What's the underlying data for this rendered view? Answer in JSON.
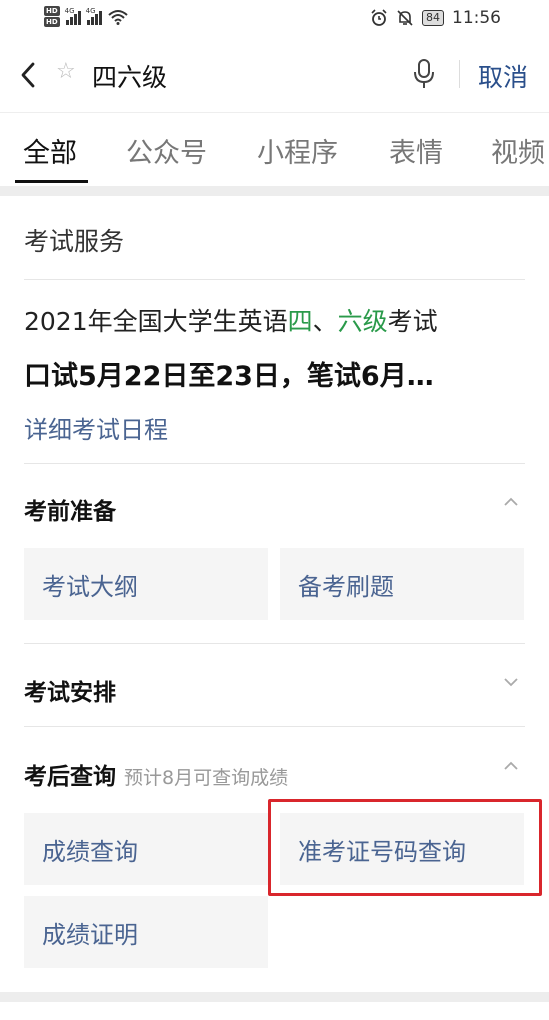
{
  "status_bar": {
    "hd_badges": [
      "HD",
      "HD"
    ],
    "sim1_network": "4G",
    "sim2_network": "4G",
    "battery": "84",
    "time": "11:56",
    "icons": [
      "signal-icon",
      "wifi-icon",
      "alarm-icon",
      "mute-icon",
      "battery-icon"
    ]
  },
  "header": {
    "query": "四六级",
    "cancel_label": "取消",
    "icons": [
      "back-icon",
      "star-icon",
      "mic-icon"
    ]
  },
  "tabs": [
    {
      "label": "全部",
      "active": true
    },
    {
      "label": "公众号",
      "active": false
    },
    {
      "label": "小程序",
      "active": false
    },
    {
      "label": "表情",
      "active": false
    },
    {
      "label": "视频",
      "active": false
    }
  ],
  "card": {
    "title": "考试服务",
    "exam": {
      "line1_prefix": "2021年全国大学生英语",
      "line1_hl1": "四",
      "line1_sep": "、",
      "line1_hl2": "六级",
      "line1_suffix": "考试",
      "line2": "口试5月22日至23日，笔试6月…",
      "schedule_link": "详细考试日程"
    },
    "sections": [
      {
        "title": "考前准备",
        "note": "",
        "expanded": true,
        "items": [
          "考试大纲",
          "备考刷题"
        ]
      },
      {
        "title": "考试安排",
        "note": "",
        "expanded": false,
        "items": []
      },
      {
        "title": "考后查询",
        "note": "预计8月可查询成绩",
        "expanded": true,
        "items": [
          "成绩查询",
          "准考证号码查询",
          "成绩证明"
        ]
      }
    ]
  },
  "colors": {
    "highlight_green": "#2a9a4a",
    "link_blue": "#4a6491",
    "cancel_blue": "#2a4f8b",
    "annotation_red": "#d9262c"
  }
}
